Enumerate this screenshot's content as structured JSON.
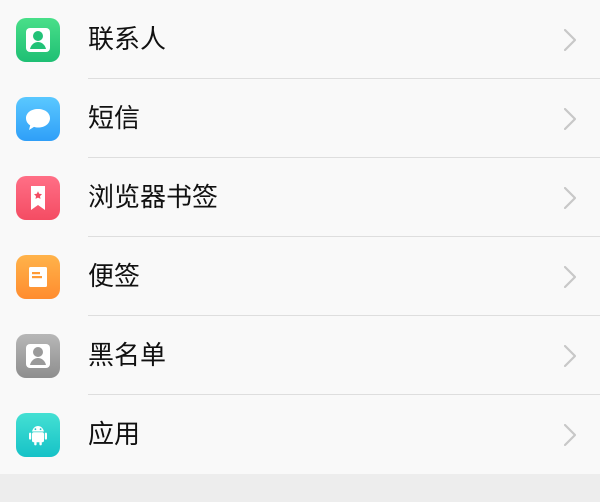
{
  "items": [
    {
      "label": "联系人",
      "icon": "contact-icon",
      "color_top": "#49df89",
      "color_bottom": "#1fbf74"
    },
    {
      "label": "短信",
      "icon": "message-icon",
      "color_top": "#5ac8ff",
      "color_bottom": "#2f9ff8"
    },
    {
      "label": "浏览器书签",
      "icon": "bookmark-icon",
      "color_top": "#ff6f86",
      "color_bottom": "#f44c63"
    },
    {
      "label": "便签",
      "icon": "note-icon",
      "color_top": "#ffb34a",
      "color_bottom": "#ff8c2f"
    },
    {
      "label": "黑名单",
      "icon": "blacklist-icon",
      "color_top": "#b7b7b7",
      "color_bottom": "#8e8e8e"
    },
    {
      "label": "应用",
      "icon": "android-icon",
      "color_top": "#44e0d3",
      "color_bottom": "#16c2c7"
    }
  ]
}
